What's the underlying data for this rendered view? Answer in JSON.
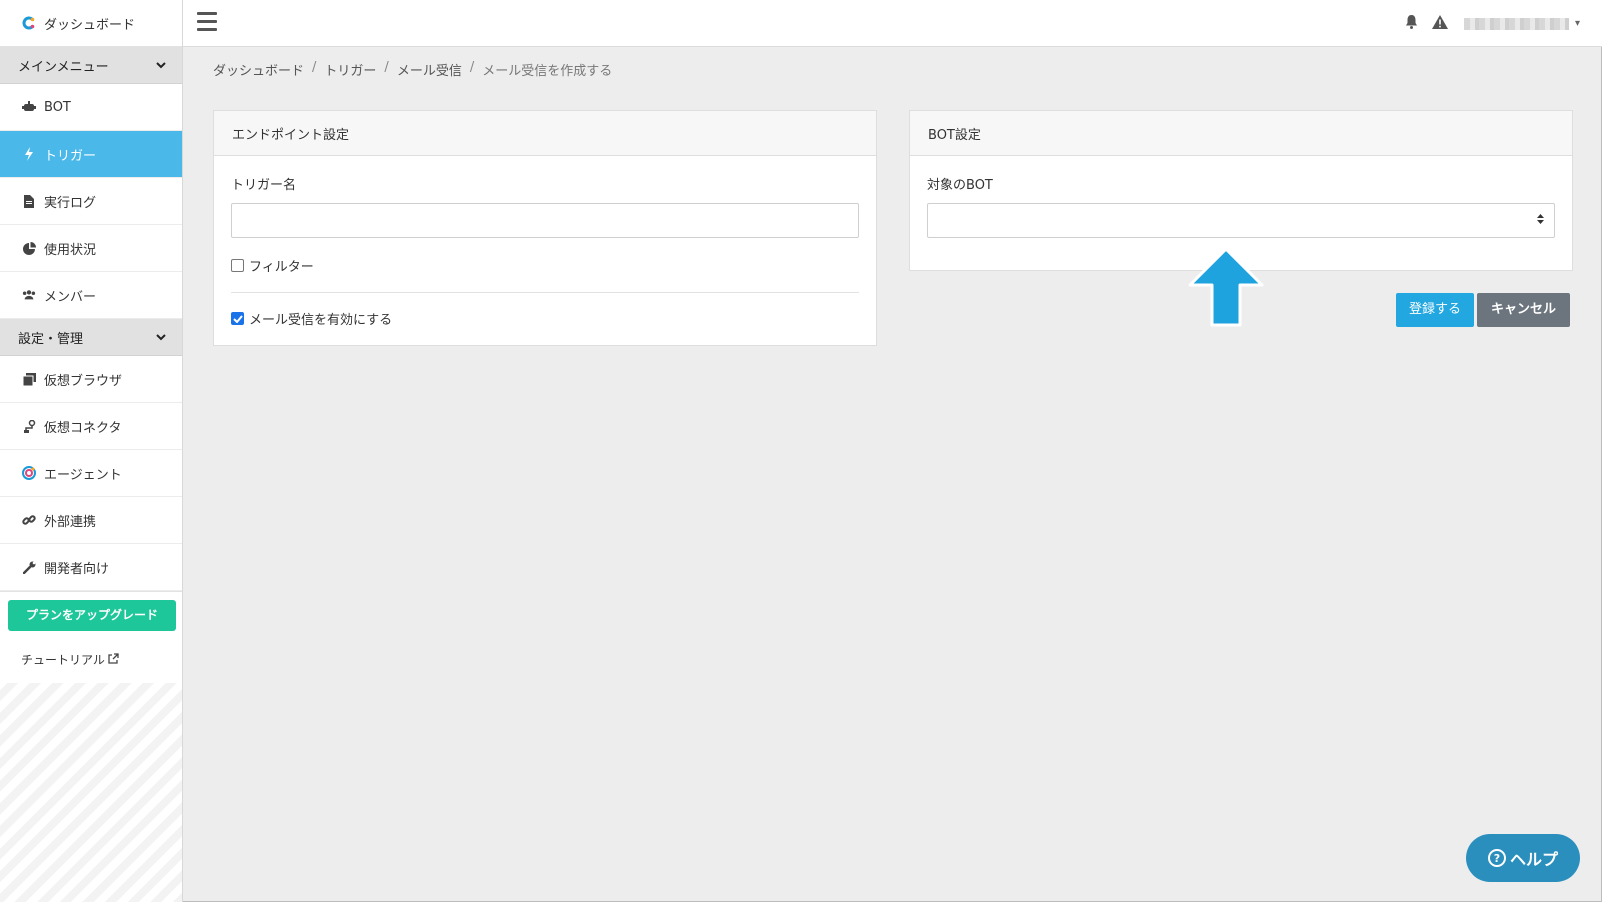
{
  "sidebar": {
    "brand": "ダッシュボード",
    "main_menu": "メインメニュー",
    "items": [
      {
        "label": "BOT",
        "icon": "robot-icon"
      },
      {
        "label": "トリガー",
        "icon": "bolt-icon"
      },
      {
        "label": "実行ログ",
        "icon": "file-icon"
      },
      {
        "label": "使用状況",
        "icon": "pie-chart-icon"
      },
      {
        "label": "メンバー",
        "icon": "users-icon"
      }
    ],
    "settings_section": "設定・管理",
    "settings_items": [
      {
        "label": "仮想ブラウザ",
        "icon": "browser-icon"
      },
      {
        "label": "仮想コネクタ",
        "icon": "connector-icon"
      },
      {
        "label": "エージェント",
        "icon": "agent-icon"
      },
      {
        "label": "外部連携",
        "icon": "link-icon"
      },
      {
        "label": "開発者向け",
        "icon": "wrench-icon"
      }
    ],
    "upgrade": "プランをアップグレード",
    "tutorial": "チュートリアル"
  },
  "breadcrumb": [
    "ダッシュボード",
    "トリガー",
    "メール受信",
    "メール受信を作成する"
  ],
  "endpoint_card": {
    "title": "エンドポイント設定",
    "name_label": "トリガー名",
    "name_value": "",
    "filter_label": "フィルター",
    "filter_checked": false,
    "enable_label": "メール受信を有効にする",
    "enable_checked": true
  },
  "bot_card": {
    "title": "BOT設定",
    "target_label": "対象のBOT",
    "target_value": ""
  },
  "actions": {
    "register": "登録する",
    "cancel": "キャンセル"
  },
  "help": "ヘルプ",
  "colors": {
    "active": "#4ab8e9",
    "primary": "#22a7e0",
    "upgrade": "#1ec79a",
    "arrow": "#1fa3de"
  }
}
